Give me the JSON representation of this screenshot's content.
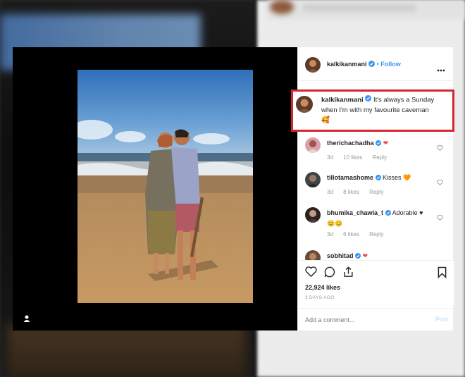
{
  "post": {
    "username": "kalkikanmani",
    "follow_separator": "•",
    "follow_label": "Follow",
    "caption_user": "kalkikanmani",
    "caption_line1": "It's always a Sunday",
    "caption_line2": "when I'm with my favourite caveman",
    "caption_emoji": "🥰"
  },
  "comments": [
    {
      "user": "therichachadha",
      "text": "",
      "emoji": "❤",
      "age": "3d",
      "likes": "10 likes",
      "reply": "Reply"
    },
    {
      "user": "tillotamashome",
      "text": "Kisses",
      "emoji": "🧡",
      "age": "3d",
      "likes": "8 likes",
      "reply": "Reply"
    },
    {
      "user": "bhumika_chawla_t",
      "text": "Adorable",
      "emoji": "♥",
      "emoji2": "😊😊",
      "age": "3d",
      "likes": "6 likes",
      "reply": "Reply"
    },
    {
      "user": "sobhitad",
      "text": "",
      "emoji": "❤"
    }
  ],
  "stats": {
    "likes": "22,924 likes",
    "posted": "3 DAYS AGO"
  },
  "composer": {
    "placeholder": "Add a comment...",
    "post_label": "Post"
  },
  "colors": {
    "accent": "#3897f0",
    "highlight_border": "#d6262d",
    "heart": "#ed4956"
  },
  "icons": [
    "user-tag-icon",
    "verified-badge-icon",
    "more-options-icon",
    "like-heart-icon",
    "comment-icon",
    "share-icon",
    "bookmark-icon"
  ]
}
